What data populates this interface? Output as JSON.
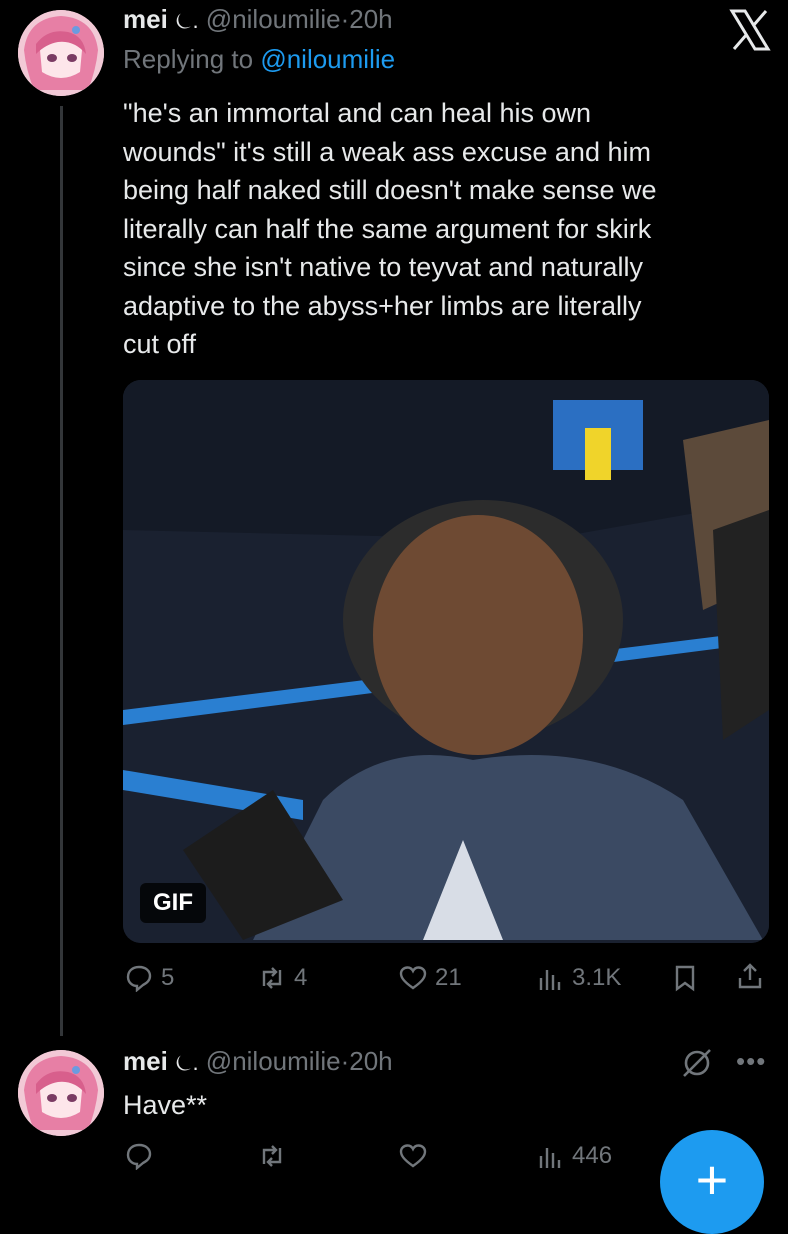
{
  "tweet1": {
    "name": "mei",
    "name_emoji": "⏾.",
    "handle": "@niloumilie",
    "separator": "·",
    "time": "20h",
    "replying_prefix": "Replying to",
    "replying_handle": "@niloumilie",
    "text_lines": [
      "\"he's an immortal and can heal his own",
      "wounds\" it's still a weak ass excuse and him",
      "being half naked still doesn't make sense we",
      "literally can half the same argument for skirk",
      "since she isn't native to teyvat and naturally",
      "adaptive to the abyss+her limbs are literally",
      "cut off"
    ],
    "media_badge": "GIF",
    "actions": {
      "replies": "5",
      "retweets": "4",
      "likes": "21",
      "views": "3.1K"
    }
  },
  "tweet2": {
    "name": "mei",
    "name_emoji": "⏾.",
    "handle": "@niloumilie",
    "separator": "·",
    "time": "20h",
    "text": "Have**",
    "actions": {
      "views": "446"
    }
  },
  "icons": {
    "close": "x-logo-icon",
    "reply": "speech-bubble-icon",
    "retweet": "retweet-icon",
    "like": "heart-icon",
    "views": "bar-chart-icon",
    "bookmark": "bookmark-icon",
    "share": "share-icon",
    "grok": "grok-icon",
    "more": "more-dots-icon",
    "compose": "plus-icon"
  },
  "colors": {
    "background": "#000000",
    "text": "#e7e9ea",
    "muted": "#71767b",
    "accent": "#1d9bf0"
  }
}
